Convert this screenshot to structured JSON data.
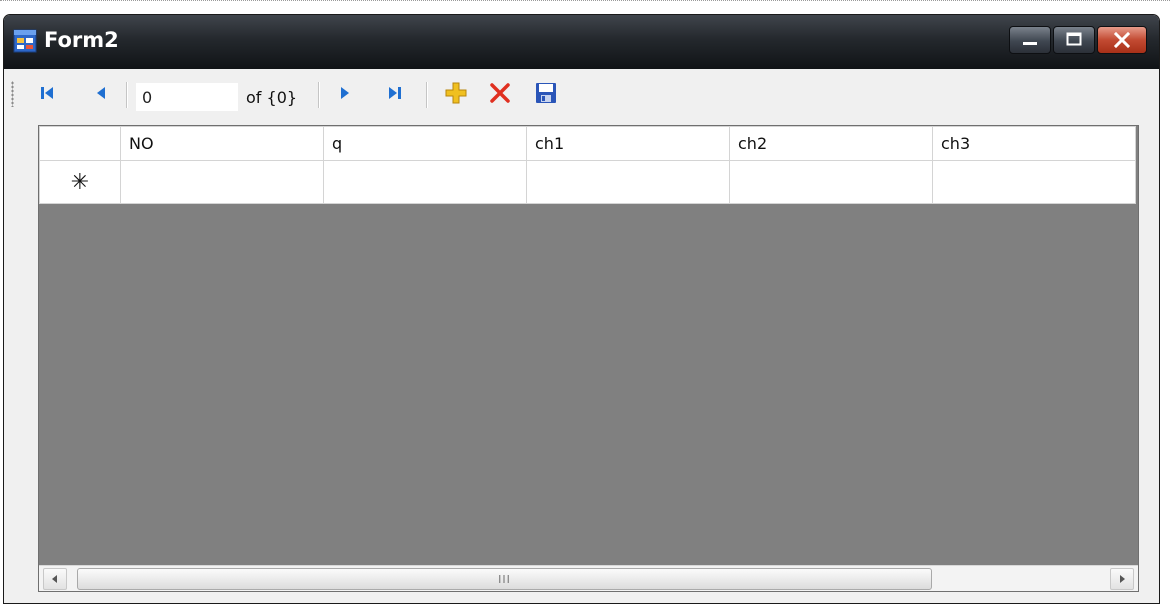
{
  "window": {
    "title": "Form2",
    "icon": "form-app-icon",
    "controls": [
      "minimize-icon",
      "maximize-icon",
      "close-icon"
    ]
  },
  "navigator": {
    "position_value": "0",
    "count_label": "of {0}",
    "buttons": [
      "move-first-icon",
      "move-previous-icon",
      "move-next-icon",
      "move-last-icon",
      "add-new-icon",
      "delete-icon",
      "save-icon"
    ],
    "colors": {
      "nav_blue": "#1f6fd1",
      "add_yellow": "#f0c020",
      "delete_red": "#e03020",
      "save_blue": "#2a55b8"
    }
  },
  "grid": {
    "columns": [
      "NO",
      "q",
      "ch1",
      "ch2",
      "ch3"
    ],
    "rows": [],
    "new_row_marker": "✳",
    "background": "#808080"
  },
  "hscroll": {
    "thumb_grip": "III"
  }
}
